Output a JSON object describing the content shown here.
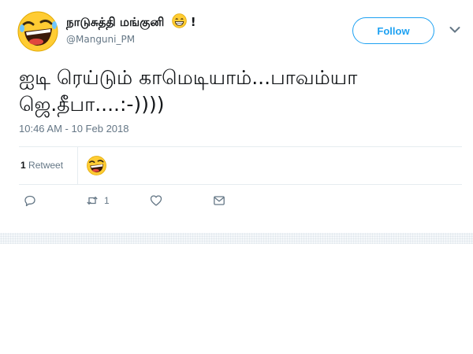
{
  "author": {
    "display_name": "நாடுசுத்தி மங்குனி",
    "name_suffix": "!",
    "handle": "@Manguni_PM",
    "avatar_icon": "laughing-emoji-icon",
    "name_emoji_icon": "grinning-emoji-icon"
  },
  "follow_button": {
    "label": "Follow"
  },
  "tweet": {
    "lines": [
      "ஐடி ரெய்டும் காமெடியாம்...பாவம்யா",
      "ஜெ.தீபா....:-))))"
    ],
    "timestamp": "10:46 AM - 10 Feb 2018"
  },
  "stats": {
    "retweet_count": "1",
    "retweet_label": "Retweet"
  },
  "actions": {
    "reply_icon": "reply-icon",
    "retweet_icon": "retweet-icon",
    "retweet_count": "1",
    "like_icon": "heart-icon",
    "message_icon": "envelope-icon"
  },
  "colors": {
    "accent": "#1da1f2",
    "secondary_text": "#657786",
    "divider": "#e6ecf0",
    "emoji_yellow": "#ffcc33"
  }
}
